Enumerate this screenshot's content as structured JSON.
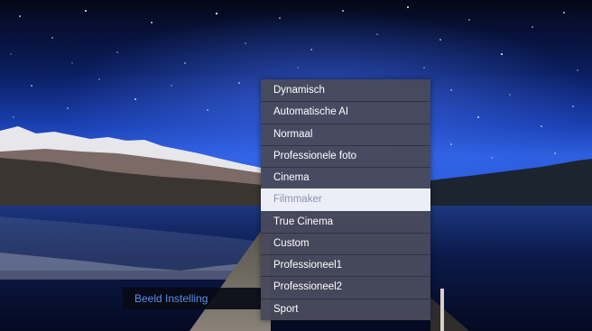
{
  "picture_setting": {
    "label": "Beeld Instelling"
  },
  "picture_mode_menu": {
    "selected_index": 5,
    "items": [
      {
        "label": "Dynamisch"
      },
      {
        "label": "Automatische AI"
      },
      {
        "label": "Normaal"
      },
      {
        "label": "Professionele foto"
      },
      {
        "label": "Cinema"
      },
      {
        "label": "Filmmaker"
      },
      {
        "label": "True Cinema"
      },
      {
        "label": "Custom"
      },
      {
        "label": "Professioneel1"
      },
      {
        "label": "Professioneel2"
      },
      {
        "label": "Sport"
      }
    ]
  },
  "colors": {
    "menu_background": "#484a5c",
    "selected_background": "#ebeef7",
    "selected_text": "#8a94ab",
    "setting_label_text": "#5b8fe6"
  }
}
